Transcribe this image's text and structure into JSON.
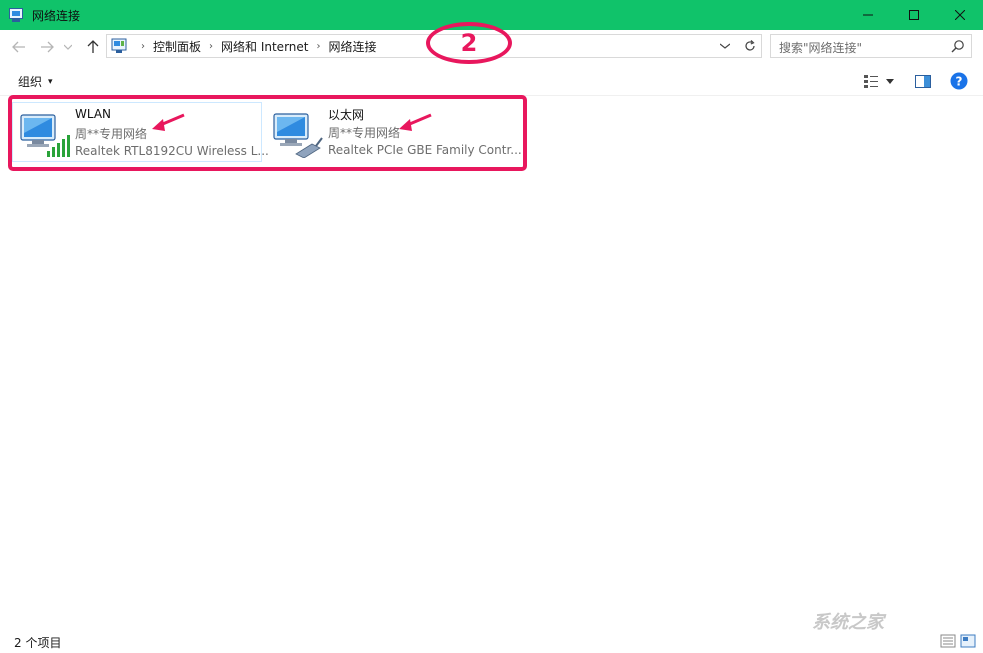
{
  "window": {
    "title": "网络连接",
    "controls": {
      "minimize": "—",
      "maximize": "☐",
      "close": "✕"
    }
  },
  "nav": {
    "back": "←",
    "forward": "→",
    "recent": "⌄",
    "up": "↑",
    "breadcrumbs": [
      "控制面板",
      "网络和 Internet",
      "网络连接"
    ],
    "separator": "›",
    "refresh": "↻",
    "dropdown": "⌄"
  },
  "search": {
    "placeholder": "搜索\"网络连接\""
  },
  "toolbar": {
    "organize": "组织",
    "caret": "▾"
  },
  "items": [
    {
      "name": "WLAN",
      "status": "周**专用网络",
      "device": "Realtek RTL8192CU Wireless L...",
      "icon": "wireless-network-icon"
    },
    {
      "name": "以太网",
      "status": "周**专用网络",
      "device": "Realtek PCIe GBE Family Contr...",
      "icon": "ethernet-network-icon"
    }
  ],
  "annotation": {
    "step_number": "2",
    "color": "#e8175d"
  },
  "statusbar": {
    "count": "2 个项目"
  },
  "watermark": "系统之家",
  "colors": {
    "titlebar": "#10c36a",
    "accent": "#1a73e8"
  }
}
